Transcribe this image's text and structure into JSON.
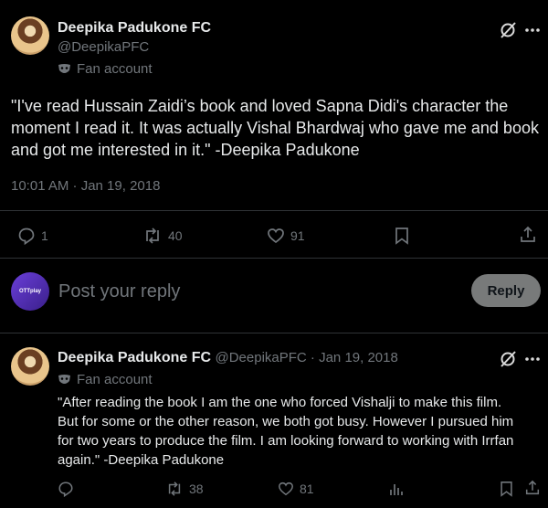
{
  "main_tweet": {
    "author_name": "Deepika Padukone FC",
    "author_handle": "@DeepikaPFC",
    "badge": "Fan account",
    "text": "\"I've read Hussain Zaidi’s book and loved Sapna Didi's character the moment I read it. It was actually Vishal Bhardwaj who gave me and book and got me interested in it.\" -Deepika Padukone",
    "text_lines": [
      "\"I've read Hussain Zaidi’s book and loved Sapna Didi's character the",
      "moment I read it. It was actually Vishal Bhardwaj who gave me and book",
      "and got me interested in it.\" -Deepika Padukone"
    ],
    "timestamp": "10:01 AM · Jan 19, 2018",
    "replies": "1",
    "reposts": "40",
    "likes": "91"
  },
  "reply_composer": {
    "placeholder": "Post your reply",
    "button_label": "Reply",
    "avatar_text": "OTTplay"
  },
  "reply_tweet": {
    "author_name": "Deepika Padukone FC",
    "meta": "@DeepikaPFC · Jan 19, 2018",
    "badge": "Fan account",
    "text_lines": [
      "\"After reading the book I am the one who forced Vishalji to make this film.",
      "But for some or the other reason, we both got busy. However I pursued him",
      "for two years to produce the film. I am looking forward to working with Irrfan",
      "again.\" -Deepika Padukone"
    ],
    "reposts": "38",
    "likes": "81"
  },
  "icons": {
    "grok": "grok-icon",
    "more": "more-icon",
    "mask": "mask-icon",
    "reply": "reply-icon",
    "repost": "repost-icon",
    "like": "heart-icon",
    "bookmark": "bookmark-icon",
    "share": "share-icon",
    "views": "views-icon"
  },
  "colors": {
    "background": "#000000",
    "text": "#e7e9ea",
    "muted": "#71767b",
    "divider": "#2f3336",
    "reply_button": "#787a7a"
  }
}
